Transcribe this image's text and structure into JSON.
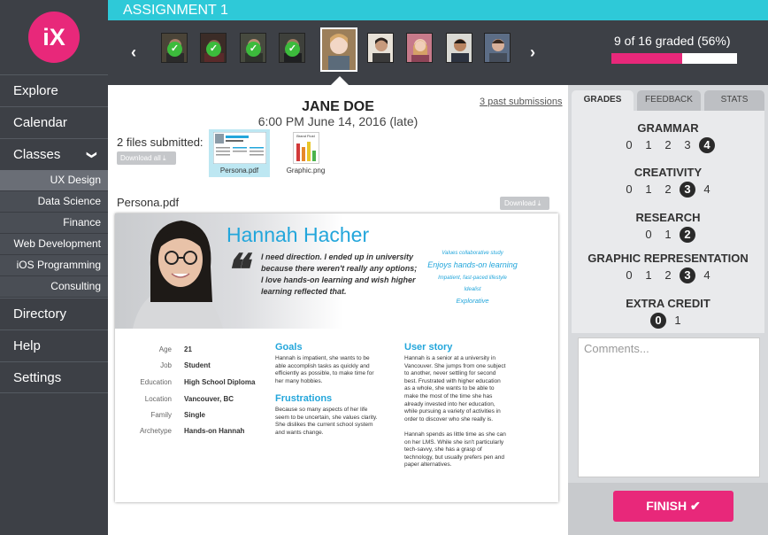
{
  "app": {
    "logo": "iX"
  },
  "sidebar": {
    "items": [
      {
        "label": "Explore"
      },
      {
        "label": "Calendar"
      },
      {
        "label": "Classes"
      }
    ],
    "classes": [
      {
        "label": "UX Design"
      },
      {
        "label": "Data Science"
      },
      {
        "label": "Finance"
      },
      {
        "label": "Web Development"
      },
      {
        "label": "iOS Programming"
      },
      {
        "label": "Consulting"
      }
    ],
    "items2": [
      {
        "label": "Directory"
      },
      {
        "label": "Help"
      },
      {
        "label": "Settings"
      }
    ],
    "chevron": "❯"
  },
  "header": {
    "assignment": "ASSIGNMENT 1",
    "graded_text": "9 of 16 graded (56%)",
    "progress": 0.56,
    "prev": "‹",
    "next": "›"
  },
  "submission": {
    "student": "JANE DOE",
    "date": "6:00 PM June 14, 2016 (late)",
    "past": "3 past submissions",
    "files_label": "2 files submitted:",
    "download_all": "Download all ⤓",
    "files": [
      {
        "name": "Persona.pdf"
      },
      {
        "name": "Graphic.png"
      }
    ],
    "graphic_title": "Brand Fluid",
    "doc_title": "Persona.pdf",
    "download": "Download ⤓"
  },
  "persona": {
    "name": "Hannah Hacher",
    "quote": [
      "I need direction. I ended up in university",
      "because there weren't really any options;",
      "I love hands-on learning and wish higher",
      "learning reflected that."
    ],
    "traits": [
      "Values collaborative study",
      "Enjoys hands-on learning",
      "Impatient, fast-paced lifestyle",
      "Idealist",
      "Explorative"
    ],
    "attributes": [
      {
        "label": "Age",
        "value": "21"
      },
      {
        "label": "Job",
        "value": "Student"
      },
      {
        "label": "Education",
        "value": "High School Diploma"
      },
      {
        "label": "Location",
        "value": "Vancouver, BC"
      },
      {
        "label": "Family",
        "value": "Single"
      },
      {
        "label": "Archetype",
        "value": "Hands-on Hannah"
      }
    ],
    "goals_title": "Goals",
    "goals": [
      "Hannah is impatient, she wants to be",
      "able accomplish tasks as quickly and",
      "efficiently as possible, to make time for",
      "her many hobbies."
    ],
    "frustrations_title": "Frustrations",
    "frustrations": [
      "Because so many aspects of her life",
      "seem to be uncertain, she values clarity.",
      "She dislikes the current school system",
      "and wants change."
    ],
    "story_title": "User story",
    "story": [
      "Hannah is a senior at a university in",
      "Vancouver. She jumps from one subject",
      "to another, never settling for second",
      "best. Frustrated with higher education",
      "as a whole, she wants to be able to",
      "make the most of the time she has",
      "already invested into her education,",
      "while pursuing a variety of activities in",
      "order to discover who she really is.",
      "",
      "Hannah spends as little time as she can",
      "on her LMS. While she isn't particularly",
      "tech-savvy, she has a grasp of",
      "technology, but usually prefers pen and",
      "paper alternatives."
    ]
  },
  "grading": {
    "tabs": [
      {
        "label": "GRADES"
      },
      {
        "label": "FEEDBACK"
      },
      {
        "label": "STATS"
      }
    ],
    "categories": [
      {
        "title": "GRAMMAR",
        "options": [
          "0",
          "1",
          "2",
          "3",
          "4"
        ],
        "selected": "4"
      },
      {
        "title": "CREATIVITY",
        "options": [
          "0",
          "1",
          "2",
          "3",
          "4"
        ],
        "selected": "3"
      },
      {
        "title": "RESEARCH",
        "options": [
          "0",
          "1",
          "2"
        ],
        "selected": "2"
      },
      {
        "title": "GRAPHIC REPRESENTATION",
        "options": [
          "0",
          "1",
          "2",
          "3",
          "4"
        ],
        "selected": "3"
      },
      {
        "title": "EXTRA CREDIT",
        "options": [
          "0",
          "1"
        ],
        "selected": "0"
      }
    ],
    "comments_placeholder": "Comments...",
    "finish": "FINISH ✔"
  },
  "colors": {
    "accent": "#e8287a",
    "teal": "#2ec9d8",
    "persona_blue": "#23a6db",
    "check_green": "#3cbb3c"
  }
}
